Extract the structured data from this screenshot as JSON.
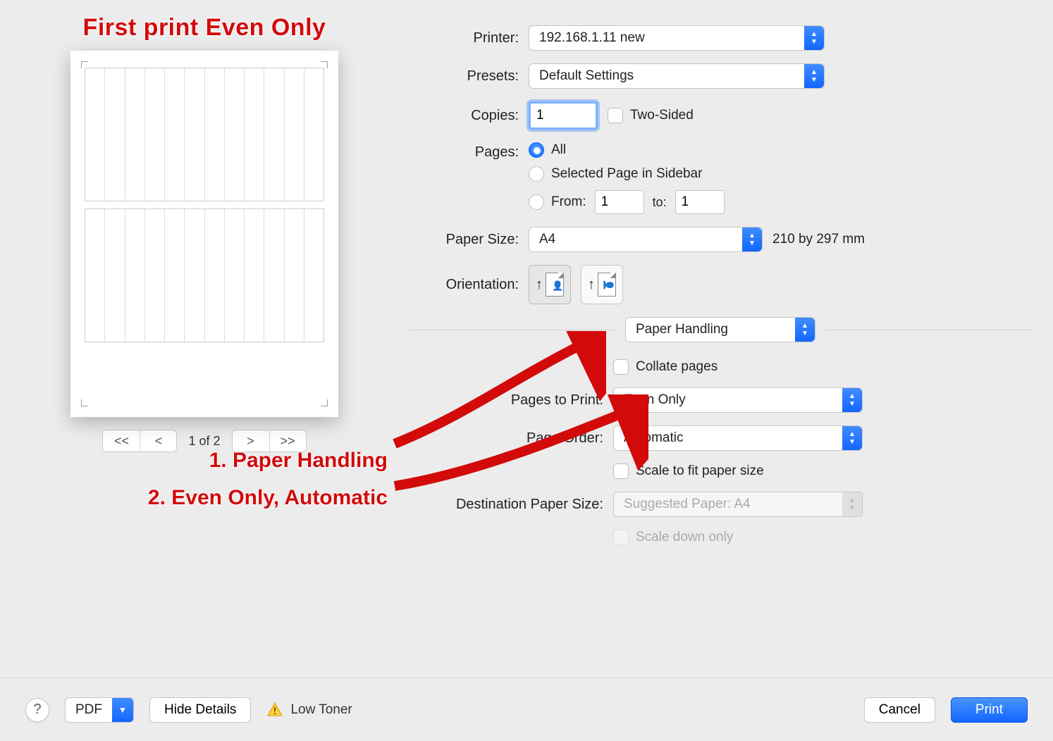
{
  "annotations": {
    "top": "First print Even Only",
    "step1": "1. Paper Handling",
    "step2": "2. Even Only, Automatic"
  },
  "preview": {
    "counter": "1 of 2"
  },
  "form": {
    "printer_label": "Printer:",
    "printer_value": "192.168.1.11 new",
    "presets_label": "Presets:",
    "presets_value": "Default Settings",
    "copies_label": "Copies:",
    "copies_value": "1",
    "twosided_label": "Two-Sided",
    "pages_label": "Pages:",
    "pages_all": "All",
    "pages_selected": "Selected Page in Sidebar",
    "pages_from": "From:",
    "pages_from_val": "1",
    "pages_to": "to:",
    "pages_to_val": "1",
    "papersize_label": "Paper Size:",
    "papersize_value": "A4",
    "papersize_dim": "210 by 297 mm",
    "orientation_label": "Orientation:",
    "section_dropdown": "Paper Handling",
    "collate_label": "Collate pages",
    "pagestoprint_label": "Pages to Print:",
    "pagestoprint_value": "Even Only",
    "pageorder_label": "Page Order:",
    "pageorder_value": "Automatic",
    "scalefit_label": "Scale to fit paper size",
    "destpaper_label": "Destination Paper Size:",
    "destpaper_value": "Suggested Paper: A4",
    "scaledown_label": "Scale down only"
  },
  "bottom": {
    "pdf": "PDF",
    "hide_details": "Hide Details",
    "low_toner": "Low Toner",
    "cancel": "Cancel",
    "print": "Print"
  }
}
